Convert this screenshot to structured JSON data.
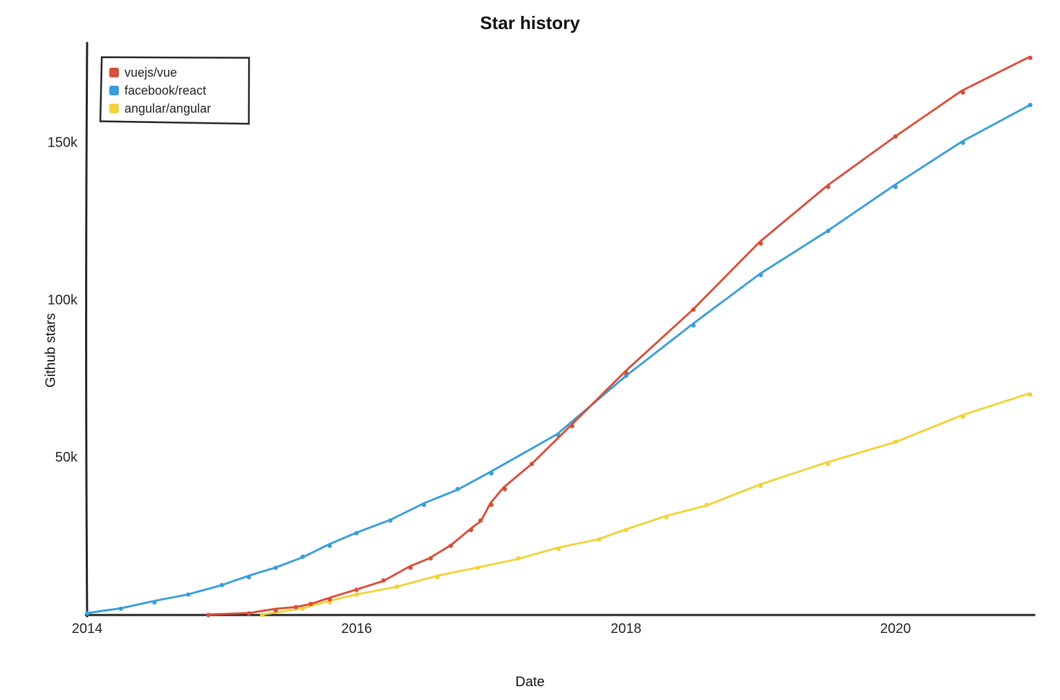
{
  "chart_data": {
    "type": "line",
    "title": "Star history",
    "xlabel": "Date",
    "ylabel": "Github stars",
    "xlim": [
      2014,
      2021
    ],
    "ylim": [
      0,
      180000
    ],
    "x_ticks": [
      2014,
      2016,
      2018,
      2020
    ],
    "x_tick_labels": [
      "2014",
      "2016",
      "2018",
      "2020"
    ],
    "y_ticks": [
      50000,
      100000,
      150000
    ],
    "y_tick_labels": [
      "50k",
      "100k",
      "150k"
    ],
    "legend_position": "top-left",
    "series": [
      {
        "name": "vuejs/vue",
        "color": "#d84f3a",
        "x": [
          2014.9,
          2015.2,
          2015.4,
          2015.55,
          2015.66,
          2015.8,
          2016.0,
          2016.2,
          2016.4,
          2016.55,
          2016.7,
          2016.85,
          2016.92,
          2017.0,
          2017.1,
          2017.3,
          2017.6,
          2018.0,
          2018.5,
          2019.0,
          2019.5,
          2020.0,
          2020.5,
          2021.0
        ],
        "y": [
          0,
          500,
          1500,
          2500,
          3500,
          5000,
          8000,
          11000,
          15000,
          18000,
          22000,
          27000,
          30000,
          35000,
          40000,
          48000,
          60000,
          77000,
          97000,
          118000,
          136000,
          152000,
          166000,
          177000
        ]
      },
      {
        "name": "facebook/react",
        "color": "#3a9fd8",
        "x": [
          2014.0,
          2014.25,
          2014.5,
          2014.75,
          2015.0,
          2015.2,
          2015.4,
          2015.6,
          2015.8,
          2016.0,
          2016.25,
          2016.5,
          2016.75,
          2017.0,
          2017.5,
          2018.0,
          2018.5,
          2019.0,
          2019.5,
          2020.0,
          2020.5,
          2021.0
        ],
        "y": [
          500,
          2000,
          4000,
          6500,
          9500,
          12000,
          15000,
          18500,
          22000,
          26000,
          30000,
          35000,
          40000,
          45000,
          57000,
          76000,
          92000,
          108000,
          122000,
          136000,
          150000,
          162000
        ]
      },
      {
        "name": "angular/angular",
        "color": "#f2d23a",
        "x": [
          2015.3,
          2015.6,
          2015.8,
          2016.0,
          2016.3,
          2016.6,
          2016.9,
          2017.2,
          2017.5,
          2017.8,
          2018.0,
          2018.3,
          2018.6,
          2019.0,
          2019.5,
          2020.0,
          2020.5,
          2021.0
        ],
        "y": [
          0,
          2000,
          4000,
          6500,
          9000,
          12000,
          15000,
          18000,
          21000,
          24000,
          27000,
          31000,
          35000,
          41000,
          48000,
          55000,
          63000,
          70000
        ]
      }
    ]
  }
}
